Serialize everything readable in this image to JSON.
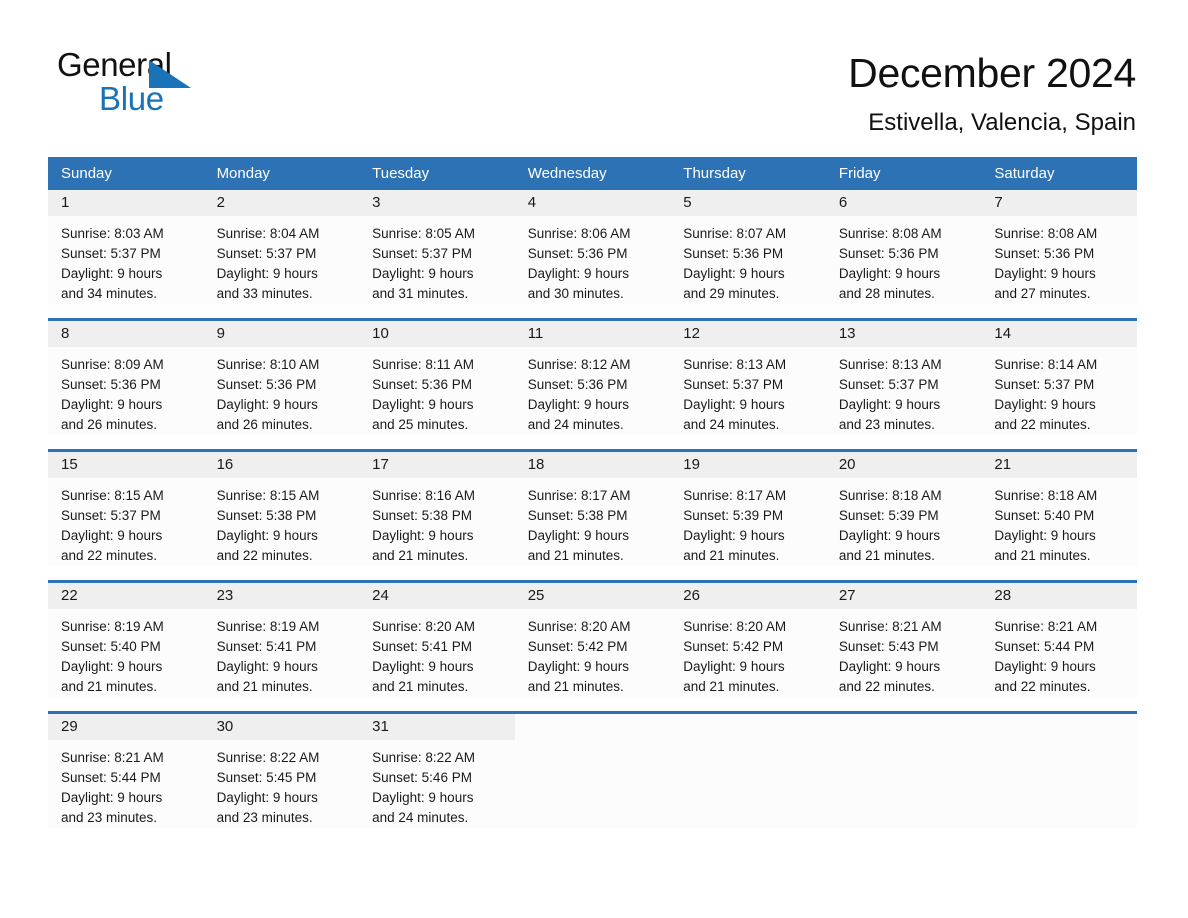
{
  "brand": {
    "name_part1": "General",
    "name_part2": "Blue",
    "triangle_color": "#1a72b8"
  },
  "header": {
    "title": "December 2024",
    "subtitle": "Estivella, Valencia, Spain"
  },
  "theme": {
    "accent": "#2d72b5",
    "daynum_band": "#efefef",
    "cell_bg": "#fcfcfc"
  },
  "weekdays": [
    "Sunday",
    "Monday",
    "Tuesday",
    "Wednesday",
    "Thursday",
    "Friday",
    "Saturday"
  ],
  "weeks": [
    [
      {
        "day": "1",
        "sunrise": "Sunrise: 8:03 AM",
        "sunset": "Sunset: 5:37 PM",
        "daylight1": "Daylight: 9 hours",
        "daylight2": "and 34 minutes."
      },
      {
        "day": "2",
        "sunrise": "Sunrise: 8:04 AM",
        "sunset": "Sunset: 5:37 PM",
        "daylight1": "Daylight: 9 hours",
        "daylight2": "and 33 minutes."
      },
      {
        "day": "3",
        "sunrise": "Sunrise: 8:05 AM",
        "sunset": "Sunset: 5:37 PM",
        "daylight1": "Daylight: 9 hours",
        "daylight2": "and 31 minutes."
      },
      {
        "day": "4",
        "sunrise": "Sunrise: 8:06 AM",
        "sunset": "Sunset: 5:36 PM",
        "daylight1": "Daylight: 9 hours",
        "daylight2": "and 30 minutes."
      },
      {
        "day": "5",
        "sunrise": "Sunrise: 8:07 AM",
        "sunset": "Sunset: 5:36 PM",
        "daylight1": "Daylight: 9 hours",
        "daylight2": "and 29 minutes."
      },
      {
        "day": "6",
        "sunrise": "Sunrise: 8:08 AM",
        "sunset": "Sunset: 5:36 PM",
        "daylight1": "Daylight: 9 hours",
        "daylight2": "and 28 minutes."
      },
      {
        "day": "7",
        "sunrise": "Sunrise: 8:08 AM",
        "sunset": "Sunset: 5:36 PM",
        "daylight1": "Daylight: 9 hours",
        "daylight2": "and 27 minutes."
      }
    ],
    [
      {
        "day": "8",
        "sunrise": "Sunrise: 8:09 AM",
        "sunset": "Sunset: 5:36 PM",
        "daylight1": "Daylight: 9 hours",
        "daylight2": "and 26 minutes."
      },
      {
        "day": "9",
        "sunrise": "Sunrise: 8:10 AM",
        "sunset": "Sunset: 5:36 PM",
        "daylight1": "Daylight: 9 hours",
        "daylight2": "and 26 minutes."
      },
      {
        "day": "10",
        "sunrise": "Sunrise: 8:11 AM",
        "sunset": "Sunset: 5:36 PM",
        "daylight1": "Daylight: 9 hours",
        "daylight2": "and 25 minutes."
      },
      {
        "day": "11",
        "sunrise": "Sunrise: 8:12 AM",
        "sunset": "Sunset: 5:36 PM",
        "daylight1": "Daylight: 9 hours",
        "daylight2": "and 24 minutes."
      },
      {
        "day": "12",
        "sunrise": "Sunrise: 8:13 AM",
        "sunset": "Sunset: 5:37 PM",
        "daylight1": "Daylight: 9 hours",
        "daylight2": "and 24 minutes."
      },
      {
        "day": "13",
        "sunrise": "Sunrise: 8:13 AM",
        "sunset": "Sunset: 5:37 PM",
        "daylight1": "Daylight: 9 hours",
        "daylight2": "and 23 minutes."
      },
      {
        "day": "14",
        "sunrise": "Sunrise: 8:14 AM",
        "sunset": "Sunset: 5:37 PM",
        "daylight1": "Daylight: 9 hours",
        "daylight2": "and 22 minutes."
      }
    ],
    [
      {
        "day": "15",
        "sunrise": "Sunrise: 8:15 AM",
        "sunset": "Sunset: 5:37 PM",
        "daylight1": "Daylight: 9 hours",
        "daylight2": "and 22 minutes."
      },
      {
        "day": "16",
        "sunrise": "Sunrise: 8:15 AM",
        "sunset": "Sunset: 5:38 PM",
        "daylight1": "Daylight: 9 hours",
        "daylight2": "and 22 minutes."
      },
      {
        "day": "17",
        "sunrise": "Sunrise: 8:16 AM",
        "sunset": "Sunset: 5:38 PM",
        "daylight1": "Daylight: 9 hours",
        "daylight2": "and 21 minutes."
      },
      {
        "day": "18",
        "sunrise": "Sunrise: 8:17 AM",
        "sunset": "Sunset: 5:38 PM",
        "daylight1": "Daylight: 9 hours",
        "daylight2": "and 21 minutes."
      },
      {
        "day": "19",
        "sunrise": "Sunrise: 8:17 AM",
        "sunset": "Sunset: 5:39 PM",
        "daylight1": "Daylight: 9 hours",
        "daylight2": "and 21 minutes."
      },
      {
        "day": "20",
        "sunrise": "Sunrise: 8:18 AM",
        "sunset": "Sunset: 5:39 PM",
        "daylight1": "Daylight: 9 hours",
        "daylight2": "and 21 minutes."
      },
      {
        "day": "21",
        "sunrise": "Sunrise: 8:18 AM",
        "sunset": "Sunset: 5:40 PM",
        "daylight1": "Daylight: 9 hours",
        "daylight2": "and 21 minutes."
      }
    ],
    [
      {
        "day": "22",
        "sunrise": "Sunrise: 8:19 AM",
        "sunset": "Sunset: 5:40 PM",
        "daylight1": "Daylight: 9 hours",
        "daylight2": "and 21 minutes."
      },
      {
        "day": "23",
        "sunrise": "Sunrise: 8:19 AM",
        "sunset": "Sunset: 5:41 PM",
        "daylight1": "Daylight: 9 hours",
        "daylight2": "and 21 minutes."
      },
      {
        "day": "24",
        "sunrise": "Sunrise: 8:20 AM",
        "sunset": "Sunset: 5:41 PM",
        "daylight1": "Daylight: 9 hours",
        "daylight2": "and 21 minutes."
      },
      {
        "day": "25",
        "sunrise": "Sunrise: 8:20 AM",
        "sunset": "Sunset: 5:42 PM",
        "daylight1": "Daylight: 9 hours",
        "daylight2": "and 21 minutes."
      },
      {
        "day": "26",
        "sunrise": "Sunrise: 8:20 AM",
        "sunset": "Sunset: 5:42 PM",
        "daylight1": "Daylight: 9 hours",
        "daylight2": "and 21 minutes."
      },
      {
        "day": "27",
        "sunrise": "Sunrise: 8:21 AM",
        "sunset": "Sunset: 5:43 PM",
        "daylight1": "Daylight: 9 hours",
        "daylight2": "and 22 minutes."
      },
      {
        "day": "28",
        "sunrise": "Sunrise: 8:21 AM",
        "sunset": "Sunset: 5:44 PM",
        "daylight1": "Daylight: 9 hours",
        "daylight2": "and 22 minutes."
      }
    ],
    [
      {
        "day": "29",
        "sunrise": "Sunrise: 8:21 AM",
        "sunset": "Sunset: 5:44 PM",
        "daylight1": "Daylight: 9 hours",
        "daylight2": "and 23 minutes."
      },
      {
        "day": "30",
        "sunrise": "Sunrise: 8:22 AM",
        "sunset": "Sunset: 5:45 PM",
        "daylight1": "Daylight: 9 hours",
        "daylight2": "and 23 minutes."
      },
      {
        "day": "31",
        "sunrise": "Sunrise: 8:22 AM",
        "sunset": "Sunset: 5:46 PM",
        "daylight1": "Daylight: 9 hours",
        "daylight2": "and 24 minutes."
      },
      {
        "day": "",
        "sunrise": "",
        "sunset": "",
        "daylight1": "",
        "daylight2": ""
      },
      {
        "day": "",
        "sunrise": "",
        "sunset": "",
        "daylight1": "",
        "daylight2": ""
      },
      {
        "day": "",
        "sunrise": "",
        "sunset": "",
        "daylight1": "",
        "daylight2": ""
      },
      {
        "day": "",
        "sunrise": "",
        "sunset": "",
        "daylight1": "",
        "daylight2": ""
      }
    ]
  ]
}
